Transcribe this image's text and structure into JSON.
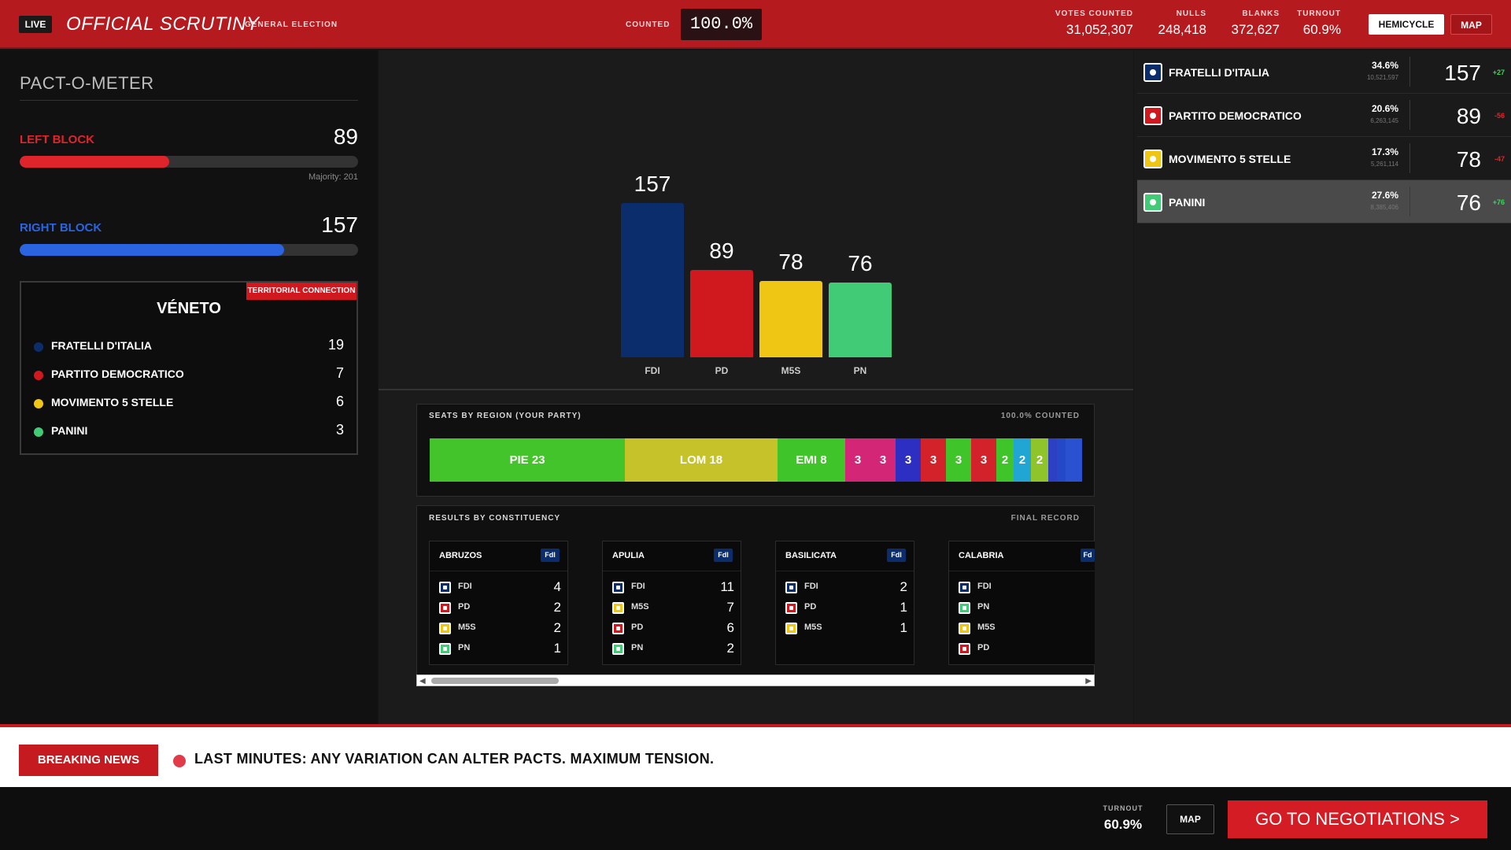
{
  "header": {
    "live": "LIVE",
    "title": "OFFICIAL SCRUTINY",
    "subtitle": "GENERAL ELECTION",
    "counted_label": "COUNTED",
    "counted_value": "100.0%",
    "stats": [
      {
        "label": "VOTES COUNTED",
        "value": "31,052,307"
      },
      {
        "label": "NULLS",
        "value": "248,418"
      },
      {
        "label": "BLANKS",
        "value": "372,627"
      },
      {
        "label": "TURNOUT",
        "value": "60.9%"
      }
    ],
    "hemicycle_button": "HEMICYCLE",
    "map_button": "MAP"
  },
  "pactometer": {
    "title": "PACT-O-METER",
    "left_block": {
      "label": "LEFT BLOCK",
      "value": "89",
      "fill_fraction": 0.443,
      "color": "#e0242b"
    },
    "majority": "Majority: 201",
    "right_block": {
      "label": "RIGHT BLOCK",
      "value": "157",
      "fill_fraction": 0.781,
      "color": "#2a64e0"
    }
  },
  "region_box": {
    "tag": "TERRITORIAL CONNECTION",
    "title": "VÉNETO",
    "rows": [
      {
        "name": "FRATELLI D'ITALIA",
        "value": "19",
        "color": "#0c2d6b"
      },
      {
        "name": "PARTITO DEMOCRATICO",
        "value": "7",
        "color": "#d0181f"
      },
      {
        "name": "MOVIMENTO 5 STELLE",
        "value": "6",
        "color": "#efc613"
      },
      {
        "name": "PANINI",
        "value": "3",
        "color": "#41cb77"
      }
    ]
  },
  "chart_data": {
    "type": "bar",
    "categories": [
      "FDI",
      "PD",
      "M5S",
      "PN"
    ],
    "values": [
      157,
      89,
      78,
      76
    ],
    "colors": [
      "#0c2d6b",
      "#d0181f",
      "#efc613",
      "#41cb77"
    ],
    "ylim": [
      0,
      157
    ]
  },
  "seats_by_region": {
    "title": "SEATS BY REGION (YOUR PARTY)",
    "status": "100.0% COUNTED",
    "segments": [
      {
        "label": "PIE 23",
        "seats": 23,
        "color": "#44c42b"
      },
      {
        "label": "LOM 18",
        "seats": 18,
        "color": "#c6c22a"
      },
      {
        "label": "EMI 8",
        "seats": 8,
        "color": "#3fc42a"
      },
      {
        "label": "3",
        "seats": 3,
        "color": "#d42677"
      },
      {
        "label": "3",
        "seats": 3,
        "color": "#d42677"
      },
      {
        "label": "3",
        "seats": 3,
        "color": "#2d2fc2"
      },
      {
        "label": "3",
        "seats": 3,
        "color": "#d4222a"
      },
      {
        "label": "3",
        "seats": 3,
        "color": "#3fc42a"
      },
      {
        "label": "3",
        "seats": 3,
        "color": "#d4222a"
      },
      {
        "label": "2",
        "seats": 2,
        "color": "#3fc42a"
      },
      {
        "label": "2",
        "seats": 2,
        "color": "#21a6d4"
      },
      {
        "label": "2",
        "seats": 2,
        "color": "#8fc42a"
      },
      {
        "label": "",
        "seats": 1,
        "color": "#2d3fc2"
      },
      {
        "label": "",
        "seats": 1,
        "color": "#2448c8"
      },
      {
        "label": "",
        "seats": 2,
        "color": "#2a52d0"
      }
    ]
  },
  "constituencies": {
    "title": "RESULTS BY CONSTITUENCY",
    "status": "FINAL RECORD",
    "cards": [
      {
        "name": "ABRUZOS",
        "badge": "FdI",
        "rows": [
          {
            "party": "FDI",
            "value": "4",
            "color": "#0c2d6b"
          },
          {
            "party": "PD",
            "value": "2",
            "color": "#d0181f"
          },
          {
            "party": "M5S",
            "value": "2",
            "color": "#efc613"
          },
          {
            "party": "PN",
            "value": "1",
            "color": "#41cb77"
          }
        ]
      },
      {
        "name": "APULIA",
        "badge": "FdI",
        "rows": [
          {
            "party": "FDI",
            "value": "11",
            "color": "#0c2d6b"
          },
          {
            "party": "M5S",
            "value": "7",
            "color": "#efc613"
          },
          {
            "party": "PD",
            "value": "6",
            "color": "#d0181f"
          },
          {
            "party": "PN",
            "value": "2",
            "color": "#41cb77"
          }
        ]
      },
      {
        "name": "BASILICATA",
        "badge": "FdI",
        "rows": [
          {
            "party": "FDI",
            "value": "2",
            "color": "#0c2d6b"
          },
          {
            "party": "PD",
            "value": "1",
            "color": "#d0181f"
          },
          {
            "party": "M5S",
            "value": "1",
            "color": "#efc613"
          }
        ]
      },
      {
        "name": "CALABRIA",
        "badge": "Fd",
        "rows": [
          {
            "party": "FDI",
            "value": "",
            "color": "#0c2d6b"
          },
          {
            "party": "PN",
            "value": "",
            "color": "#41cb77"
          },
          {
            "party": "M5S",
            "value": "",
            "color": "#efc613"
          },
          {
            "party": "PD",
            "value": "",
            "color": "#d0181f"
          }
        ]
      }
    ]
  },
  "parties": [
    {
      "name": "FRATELLI D'ITALIA",
      "pct": "34.6%",
      "votes": "10,521,597",
      "seats": "157",
      "delta": "+27",
      "delta_color": "#3fd45a",
      "color": "#0c2d6b",
      "icon": "flame-icon"
    },
    {
      "name": "PARTITO DEMOCRATICO",
      "pct": "20.6%",
      "votes": "6,263,145",
      "seats": "89",
      "delta": "-56",
      "delta_color": "#e0242b",
      "color": "#d0181f",
      "icon": "pd-logo-icon"
    },
    {
      "name": "MOVIMENTO 5 STELLE",
      "pct": "17.3%",
      "votes": "5,261,114",
      "seats": "78",
      "delta": "-47",
      "delta_color": "#e0242b",
      "color": "#efc613",
      "icon": "star-icon"
    },
    {
      "name": "PANINI",
      "pct": "27.6%",
      "votes": "8,385,406",
      "seats": "76",
      "delta": "+76",
      "delta_color": "#3fd45a",
      "color": "#41cb77",
      "icon": "panini-icon"
    }
  ],
  "news": {
    "badge": "BREAKING NEWS",
    "text": "LAST MINUTES: ANY VARIATION CAN ALTER PACTS. MAXIMUM TENSION."
  },
  "footer": {
    "turnout_label": "TURNOUT",
    "turnout_value": "60.9%",
    "map_button": "MAP",
    "negotiations_button": "GO TO NEGOTIATIONS >"
  }
}
